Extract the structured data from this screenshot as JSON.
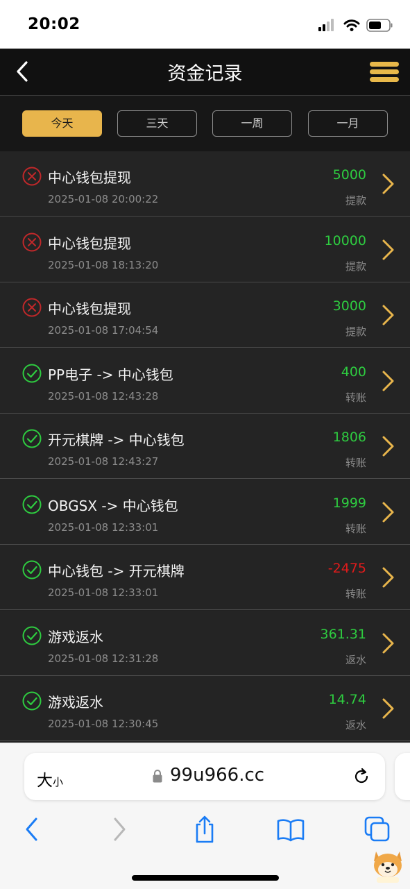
{
  "status_bar": {
    "time": "20:02"
  },
  "header": {
    "title": "资金记录"
  },
  "filters": [
    {
      "label": "今天",
      "active": true
    },
    {
      "label": "三天",
      "active": false
    },
    {
      "label": "一周",
      "active": false
    },
    {
      "label": "一月",
      "active": false
    }
  ],
  "records": [
    {
      "status": "failed",
      "title": "中心钱包提现",
      "datetime": "2025-01-08 20:00:22",
      "amount": "5000",
      "type": "提款",
      "amount_color": "#2ecc40"
    },
    {
      "status": "failed",
      "title": "中心钱包提现",
      "datetime": "2025-01-08 18:13:20",
      "amount": "10000",
      "type": "提款",
      "amount_color": "#2ecc40"
    },
    {
      "status": "failed",
      "title": "中心钱包提现",
      "datetime": "2025-01-08 17:04:54",
      "amount": "3000",
      "type": "提款",
      "amount_color": "#2ecc40"
    },
    {
      "status": "success",
      "title": "PP电子 -> 中心钱包",
      "datetime": "2025-01-08 12:43:28",
      "amount": "400",
      "type": "转账",
      "amount_color": "#2ecc40"
    },
    {
      "status": "success",
      "title": "开元棋牌 -> 中心钱包",
      "datetime": "2025-01-08 12:43:27",
      "amount": "1806",
      "type": "转账",
      "amount_color": "#2ecc40"
    },
    {
      "status": "success",
      "title": "OBGSX -> 中心钱包",
      "datetime": "2025-01-08 12:33:01",
      "amount": "1999",
      "type": "转账",
      "amount_color": "#2ecc40"
    },
    {
      "status": "success",
      "title": "中心钱包 -> 开元棋牌",
      "datetime": "2025-01-08 12:33:01",
      "amount": "-2475",
      "type": "转账",
      "amount_color": "#e01b1b"
    },
    {
      "status": "success",
      "title": "游戏返水",
      "datetime": "2025-01-08 12:31:28",
      "amount": "361.31",
      "type": "返水",
      "amount_color": "#2ecc40"
    },
    {
      "status": "success",
      "title": "游戏返水",
      "datetime": "2025-01-08 12:30:45",
      "amount": "14.74",
      "type": "返水",
      "amount_color": "#2ecc40"
    }
  ],
  "browser": {
    "text_size_label": "大",
    "text_size_small": "小",
    "url": "99u966.cc"
  },
  "colors": {
    "accent": "#e8b54c",
    "success": "#2ecc40",
    "fail": "#c0282a",
    "ios_blue": "#1a7cf5"
  },
  "icons": {
    "failed": "x-circle-icon",
    "success": "check-circle-icon",
    "row_arrow": "chevron-right-icon"
  }
}
